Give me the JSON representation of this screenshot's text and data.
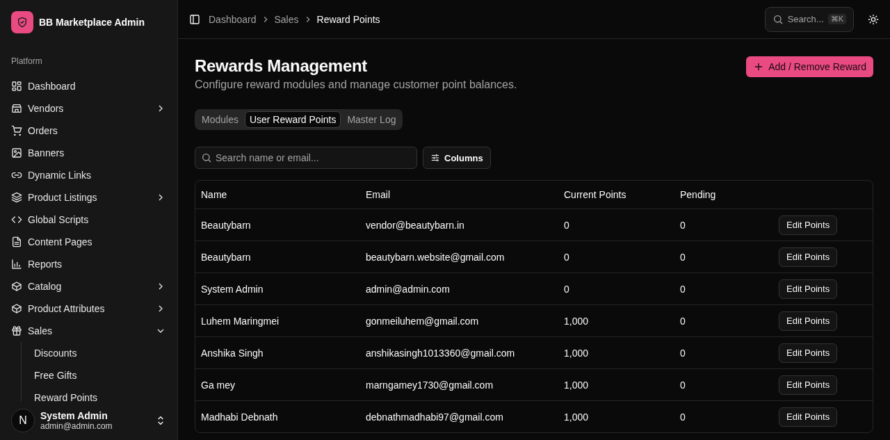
{
  "app": {
    "name": "BB Marketplace Admin"
  },
  "sidebar": {
    "section": "Platform",
    "items": [
      {
        "label": "Dashboard",
        "selected": false
      },
      {
        "label": "Vendors",
        "expanded": false,
        "selected": false
      },
      {
        "label": "Orders",
        "selected": false
      },
      {
        "label": "Banners",
        "selected": false
      },
      {
        "label": "Dynamic Links",
        "selected": false
      },
      {
        "label": "Product Listings",
        "expanded": false,
        "selected": false
      },
      {
        "label": "Global Scripts",
        "selected": false
      },
      {
        "label": "Content Pages",
        "selected": false
      },
      {
        "label": "Reports",
        "selected": false
      },
      {
        "label": "Catalog",
        "expanded": false,
        "selected": false
      },
      {
        "label": "Product Attributes",
        "expanded": false,
        "selected": false
      },
      {
        "label": "Sales",
        "expanded": true,
        "selected": false,
        "children": [
          {
            "label": "Discounts",
            "selected": false
          },
          {
            "label": "Free Gifts",
            "selected": false
          },
          {
            "label": "Reward Points",
            "selected": false
          }
        ]
      }
    ]
  },
  "user": {
    "initial": "N",
    "name": "System Admin",
    "email": "admin@admin.com"
  },
  "breadcrumbs": [
    "Dashboard",
    "Sales",
    "Reward Points"
  ],
  "search": {
    "placeholder": "Search...",
    "shortcut": "⌘K"
  },
  "page": {
    "title": "Rewards Management",
    "subtitle": "Configure reward modules and manage customer point balances.",
    "action": "Add / Remove Reward"
  },
  "tabs": [
    {
      "label": "Modules",
      "selected": false
    },
    {
      "label": "User Reward Points",
      "selected": true
    },
    {
      "label": "Master Log",
      "selected": false
    }
  ],
  "filter": {
    "placeholder": "Search name or email...",
    "columns_button": "Columns"
  },
  "table": {
    "columns": [
      "Name",
      "Email",
      "Current Points",
      "Pending"
    ],
    "rows": [
      {
        "name": "Beautybarn",
        "email": "vendor@beautybarn.in",
        "points": "0",
        "pending": "0",
        "action": "Edit Points"
      },
      {
        "name": "Beautybarn",
        "email": "beautybarn.website@gmail.com",
        "points": "0",
        "pending": "0",
        "action": "Edit Points"
      },
      {
        "name": "System Admin",
        "email": "admin@admin.com",
        "points": "0",
        "pending": "0",
        "action": "Edit Points"
      },
      {
        "name": "Luhem Maringmei",
        "email": "gonmeiluhem@gmail.com",
        "points": "1,000",
        "pending": "0",
        "action": "Edit Points"
      },
      {
        "name": "Anshika Singh",
        "email": "anshikasingh1013360@gmail.com",
        "points": "1,000",
        "pending": "0",
        "action": "Edit Points"
      },
      {
        "name": "Ga mey",
        "email": "marngamey1730@gmail.com",
        "points": "1,000",
        "pending": "0",
        "action": "Edit Points"
      },
      {
        "name": "Madhabi Debnath",
        "email": "debnathmadhabi97@gmail.com",
        "points": "1,000",
        "pending": "0",
        "action": "Edit Points"
      }
    ]
  }
}
